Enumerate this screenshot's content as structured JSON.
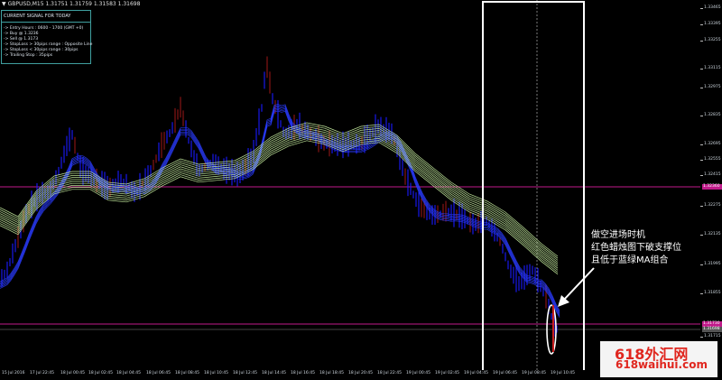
{
  "header": {
    "arrow": "▼",
    "text": "GBPUSD,M15  1.31751 1.31759 1.31583 1.31698"
  },
  "signal_panel": {
    "title": "CURRENT SIGNAL FOR TODAY",
    "lines": [
      "-> Entry Hours : 0600 - 1700 (GMT +0)",
      "-> Buy @ 1.3236",
      "-> Sell @ 1.3173",
      "-> StopLoss > 30pips range : Opposite Line",
      "-> StopLoss < 30pips range : 30pips",
      "-> Trailing Stop : 35pips"
    ]
  },
  "price_axis": {
    "labels": [
      "1.33465",
      "1.33395",
      "1.33255",
      "1.33115",
      "1.32975",
      "1.32835",
      "1.32695",
      "1.32555",
      "1.32415",
      "1.32275",
      "1.32135",
      "1.31995",
      "1.31855",
      "1.31715"
    ],
    "buy_level_label": "1.32360",
    "sell_level_label": "1.31730",
    "current_price_label": "1.31698"
  },
  "time_axis": {
    "labels": [
      "15 Jul 2016",
      "17 Jul 22:45",
      "18 Jul 00:45",
      "18 Jul 02:45",
      "18 Jul 04:45",
      "18 Jul 06:45",
      "18 Jul 08:45",
      "18 Jul 10:45",
      "18 Jul 12:45",
      "18 Jul 14:45",
      "18 Jul 16:45",
      "18 Jul 18:45",
      "18 Jul 20:45",
      "18 Jul 22:45",
      "19 Jul 00:45",
      "19 Jul 02:45",
      "19 Jul 04:45",
      "19 Jul 06:45",
      "19 Jul 08:45",
      "19 Jul 10:45"
    ]
  },
  "annotation": {
    "lines": [
      "做空进场时机",
      "红色蜡烛图下破支撑位",
      "且低于蓝绿MA组合"
    ]
  },
  "watermark": {
    "line1": "618外汇网",
    "line2": "618waihui.com"
  },
  "colors": {
    "background": "#000000",
    "bull_candle": "#1a1aff",
    "bear_candle": "#c81e1e",
    "ma_ribbon": "#c8f0a0",
    "level_line": "#c01a8a",
    "highlight": "#ffffff"
  }
}
